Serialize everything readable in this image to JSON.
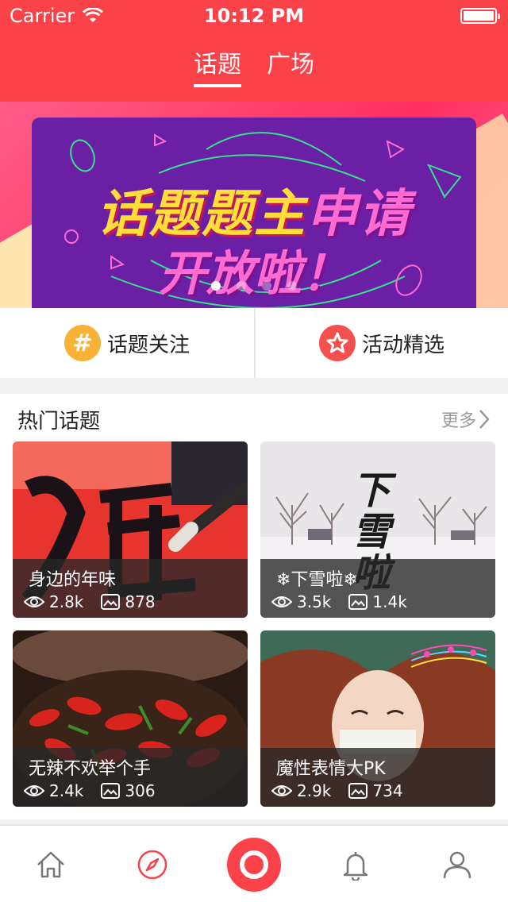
{
  "status_bar": {
    "carrier": "Carrier",
    "time": "10:12 PM"
  },
  "header": {
    "tabs": [
      {
        "label": "话题",
        "active": true
      },
      {
        "label": "广场",
        "active": false
      }
    ]
  },
  "banner": {
    "line1_part1": "话题题主",
    "line1_part2": "申请",
    "line2": "开放啦！",
    "pages": 4,
    "current_page": 1
  },
  "quick_actions": [
    {
      "label": "话题关注",
      "icon": "hash-icon"
    },
    {
      "label": "活动精选",
      "icon": "star-icon"
    }
  ],
  "hot_topics": {
    "title": "热门话题",
    "more_label": "更多",
    "items": [
      {
        "title": "身边的年味",
        "views": "2.8k",
        "images": "878"
      },
      {
        "title": "❄下雪啦❄",
        "views": "3.5k",
        "images": "1.4k",
        "photo_text": "下雪啦"
      },
      {
        "title": "无辣不欢举个手",
        "views": "2.4k",
        "images": "306"
      },
      {
        "title": "魔性表情大PK",
        "views": "2.9k",
        "images": "734"
      }
    ]
  },
  "tab_bar": {
    "items": [
      "home-icon",
      "compass-icon",
      "record-button",
      "bell-icon",
      "user-icon"
    ],
    "active": "compass-icon"
  },
  "colors": {
    "brand": "#fb4248",
    "accent_yellow": "#f8b336",
    "accent_red": "#f4504e"
  }
}
